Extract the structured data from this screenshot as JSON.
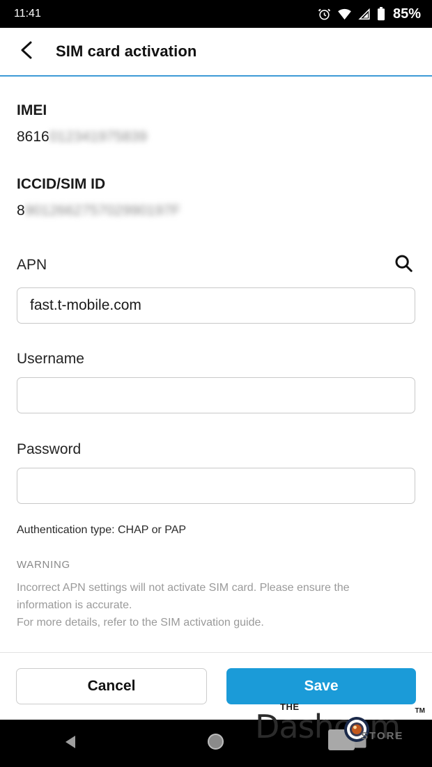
{
  "status_bar": {
    "clock": "11:41",
    "battery_percent": "85%",
    "icons": [
      "alarm-icon",
      "wifi-icon",
      "cellular-signal-icon",
      "battery-icon"
    ]
  },
  "app_bar": {
    "back_icon": "chevron-left-icon",
    "title": "SIM card activation",
    "divider_color": "#3d9ad6"
  },
  "form": {
    "imei": {
      "label": "IMEI",
      "value_visible": "8616",
      "value_redacted": "012341975839"
    },
    "iccid": {
      "label": "ICCID/SIM ID",
      "value_visible": "8",
      "value_redacted": "901266275702990197F"
    },
    "apn": {
      "label": "APN",
      "search_icon": "search-icon",
      "value": "fast.t-mobile.com",
      "placeholder": ""
    },
    "username": {
      "label": "Username",
      "value": "",
      "placeholder": ""
    },
    "password": {
      "label": "Password",
      "value": "",
      "placeholder": ""
    },
    "auth_note": "Authentication type: CHAP or PAP"
  },
  "warning": {
    "title": "WARNING",
    "line1": "Incorrect APN settings will not activate SIM card. Please ensure the",
    "line2": "information is accurate.",
    "line3": "For more details, refer to the SIM activation guide."
  },
  "footer": {
    "cancel_label": "Cancel",
    "save_label": "Save",
    "save_color": "#1b9bd8"
  },
  "watermark": {
    "the": "THE",
    "brand": "Dashcam",
    "store": "STORE",
    "tm": "TM"
  },
  "nav_bar": {
    "back": "nav-back-icon",
    "home": "nav-home-icon",
    "recents": "nav-recents-icon"
  }
}
